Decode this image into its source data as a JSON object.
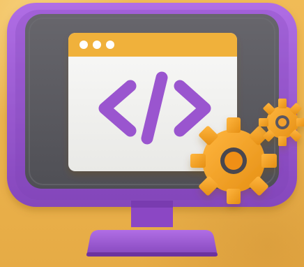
{
  "image": {
    "subject": "3d-monitor-code-gears",
    "colors": {
      "background": "#e9b24a",
      "monitor_frame": "#9b59d0",
      "monitor_frame_dark": "#7d3fb4",
      "screen_bezel": "#5d5d63",
      "window_body": "#f3f3f1",
      "window_titlebar": "#f0b13b",
      "code_symbol": "#9a55cf",
      "gear": "#f2a12d"
    },
    "icons": [
      "code-brackets-icon",
      "gear-icon",
      "gear-icon"
    ]
  }
}
